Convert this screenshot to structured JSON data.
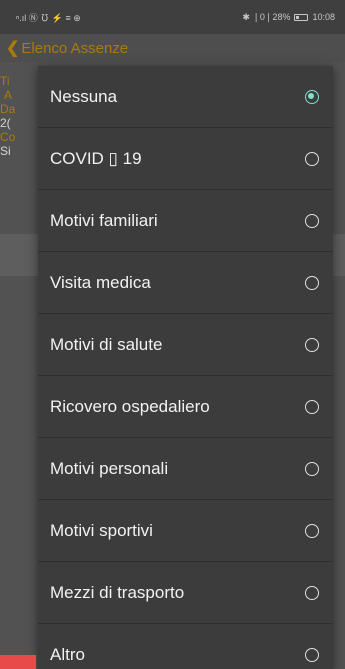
{
  "status_bar": {
    "left_icons": "ⁿ.ıl Ⓝ ℧ ⚡ ≡ ⊕",
    "right_text": "✱ ❘0❘28%",
    "battery_icon": "battery-icon",
    "time": "10:08"
  },
  "header": {
    "back_icon": "❮",
    "title": "Elenco Assenze"
  },
  "background": {
    "rows": [
      "Ti",
      "A",
      "Da",
      "2(",
      "Co",
      "Si"
    ]
  },
  "dialog": {
    "options": [
      {
        "label": "Nessuna",
        "selected": true
      },
      {
        "label": "COVID ▯ 19",
        "selected": false
      },
      {
        "label": "Motivi familiari",
        "selected": false
      },
      {
        "label": "Visita medica",
        "selected": false
      },
      {
        "label": "Motivi di salute",
        "selected": false
      },
      {
        "label": "Ricovero ospedaliero",
        "selected": false
      },
      {
        "label": "Motivi personali",
        "selected": false
      },
      {
        "label": "Motivi sportivi",
        "selected": false
      },
      {
        "label": "Mezzi di trasporto",
        "selected": false
      },
      {
        "label": "Altro",
        "selected": false
      }
    ]
  },
  "colors": {
    "accent": "#7fe0cc",
    "header_text": "#b8860b",
    "dialog_bg": "#3c3c3c"
  }
}
